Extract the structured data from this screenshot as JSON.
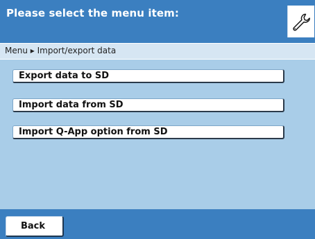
{
  "header": {
    "title": "Please select the menu item:",
    "icon": "wrench-icon"
  },
  "breadcrumb": {
    "text": "Menu ▸ Import/export data"
  },
  "menu": {
    "items": [
      {
        "label": "Export data to SD"
      },
      {
        "label": "Import data from SD"
      },
      {
        "label": "Import Q-App option from SD"
      }
    ]
  },
  "footer": {
    "back_label": "Back"
  },
  "colors": {
    "header_blue": "#3b7fc0",
    "content_blue": "#a9cde8",
    "breadcrumb_bg": "#d6e6f3"
  }
}
